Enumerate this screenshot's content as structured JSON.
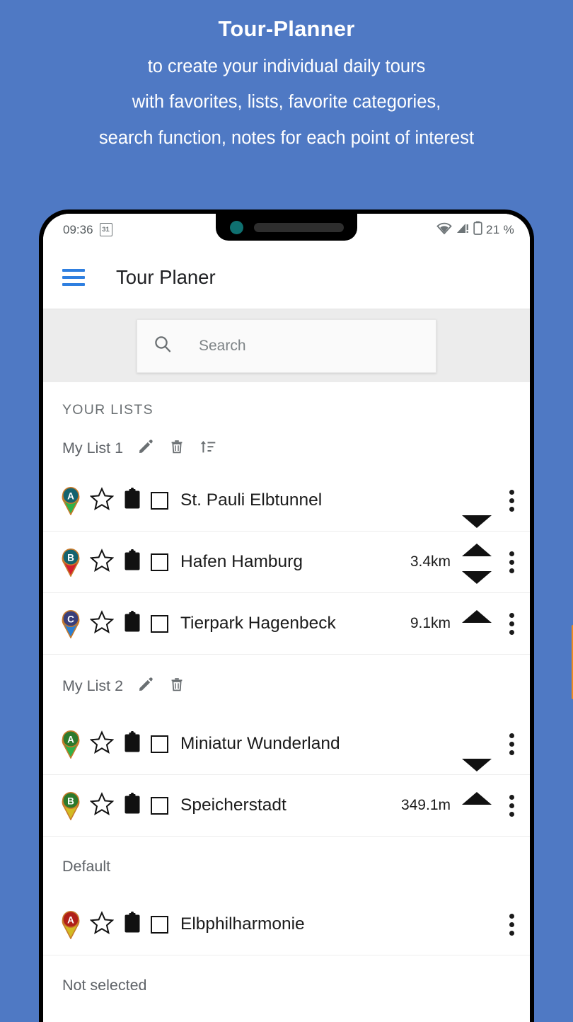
{
  "promo": {
    "title": "Tour-Planner",
    "lines": [
      "to create your individual daily tours",
      "with favorites, lists, favorite categories,",
      "search function, notes for each point of interest"
    ],
    "background_color": "#4f79c4",
    "text_color": "#ffffff"
  },
  "status_bar": {
    "time": "09:36",
    "calendar_day": "31",
    "wifi_icon": "wifi-icon",
    "signal_icon": "signal-warning-icon",
    "battery_icon": "battery-icon",
    "battery_level": "21 %"
  },
  "app_bar": {
    "menu_icon": "hamburger-menu-icon",
    "title": "Tour Planer",
    "accent_color": "#2f7fe0"
  },
  "search": {
    "icon": "search-icon",
    "placeholder": "Search",
    "value": ""
  },
  "sections": [
    {
      "kind": "label",
      "label": "YOUR LISTS"
    },
    {
      "kind": "list",
      "name": "My List 1",
      "actions": [
        "edit-icon",
        "delete-icon",
        "sort-icon"
      ],
      "items": [
        {
          "pin_letter": "A",
          "pin_circle_color": "#14636e",
          "pin_point_color": "#2fb14a",
          "pin_outline_color": "#c87a2a",
          "favorite_icon": "star-outline-icon",
          "note_icon": "clipboard-icon",
          "checked": false,
          "name": "St. Pauli Elbtunnel",
          "distance": "",
          "move_up": false,
          "move_down": true
        },
        {
          "pin_letter": "B",
          "pin_circle_color": "#14636e",
          "pin_point_color": "#d3202f",
          "pin_outline_color": "#c87a2a",
          "favorite_icon": "star-outline-icon",
          "note_icon": "clipboard-icon",
          "checked": false,
          "name": "Hafen Hamburg",
          "distance": "3.4km",
          "move_up": true,
          "move_down": true
        },
        {
          "pin_letter": "C",
          "pin_circle_color": "#3a3f7a",
          "pin_point_color": "#2a7fd4",
          "pin_outline_color": "#c87a2a",
          "favorite_icon": "star-outline-icon",
          "note_icon": "clipboard-icon",
          "checked": false,
          "name": "Tierpark Hagenbeck",
          "distance": "9.1km",
          "move_up": true,
          "move_down": false
        }
      ]
    },
    {
      "kind": "list",
      "name": "My List 2",
      "actions": [
        "edit-icon",
        "delete-icon"
      ],
      "items": [
        {
          "pin_letter": "A",
          "pin_circle_color": "#2c7a2c",
          "pin_point_color": "#2fb14a",
          "pin_outline_color": "#c87a2a",
          "favorite_icon": "star-outline-icon",
          "note_icon": "clipboard-icon",
          "checked": false,
          "name": "Miniatur Wunderland",
          "distance": "",
          "move_up": false,
          "move_down": true
        },
        {
          "pin_letter": "B",
          "pin_circle_color": "#2c7a2c",
          "pin_point_color": "#d2bb23",
          "pin_outline_color": "#c87a2a",
          "favorite_icon": "star-outline-icon",
          "note_icon": "clipboard-icon",
          "checked": false,
          "name": "Speicherstadt",
          "distance": "349.1m",
          "move_up": true,
          "move_down": false
        }
      ]
    },
    {
      "kind": "plain",
      "name": "Default",
      "items": [
        {
          "pin_letter": "A",
          "pin_circle_color": "#b02018",
          "pin_point_color": "#d2bb23",
          "pin_outline_color": "#c87a2a",
          "favorite_icon": "star-outline-icon",
          "note_icon": "clipboard-icon",
          "checked": false,
          "name": "Elbphilharmonie",
          "distance": "",
          "move_up": false,
          "move_down": false
        }
      ]
    },
    {
      "kind": "plain",
      "name": "Not selected",
      "items": []
    }
  ],
  "phone": {
    "side_button_color": "#f08a1e",
    "notch_camera_color": "#0f7070"
  }
}
